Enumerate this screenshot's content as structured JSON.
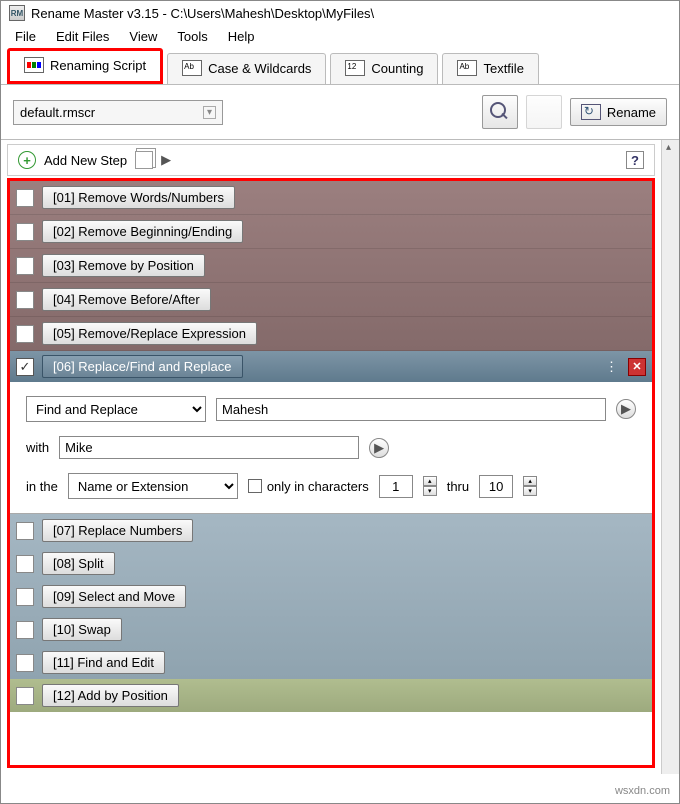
{
  "title": "Rename Master v3.15 - C:\\Users\\Mahesh\\Desktop\\MyFiles\\",
  "menu": {
    "file": "File",
    "edit": "Edit Files",
    "view": "View",
    "tools": "Tools",
    "help": "Help"
  },
  "tabs": {
    "renaming": "Renaming Script",
    "case": "Case & Wildcards",
    "counting": "Counting",
    "textfile": "Textfile"
  },
  "toolbar": {
    "script": "default.rmscr",
    "rename": "Rename"
  },
  "addstep": {
    "label": "Add New Step",
    "help": "?"
  },
  "steps": {
    "s1": "[01]  Remove Words/Numbers",
    "s2": "[02]  Remove Beginning/Ending",
    "s3": "[03]  Remove by Position",
    "s4": "[04]  Remove Before/After",
    "s5": "[05]  Remove/Replace Expression",
    "s6": "[06]  Replace/Find and Replace",
    "s7": "[07]  Replace Numbers",
    "s8": "[08]  Split",
    "s9": "[09]  Select and Move",
    "s10": "[10]  Swap",
    "s11": "[11]  Find and Edit",
    "s12": "[12]  Add by Position"
  },
  "step6": {
    "mode": "Find and Replace",
    "find": "Mahesh",
    "withlbl": "with",
    "with": "Mike",
    "inthelbl": "in the",
    "scope": "Name or Extension",
    "onlylbl": "only in characters",
    "from": "1",
    "thru_lbl": "thru",
    "thru": "10"
  },
  "watermark": "wsxdn.com"
}
